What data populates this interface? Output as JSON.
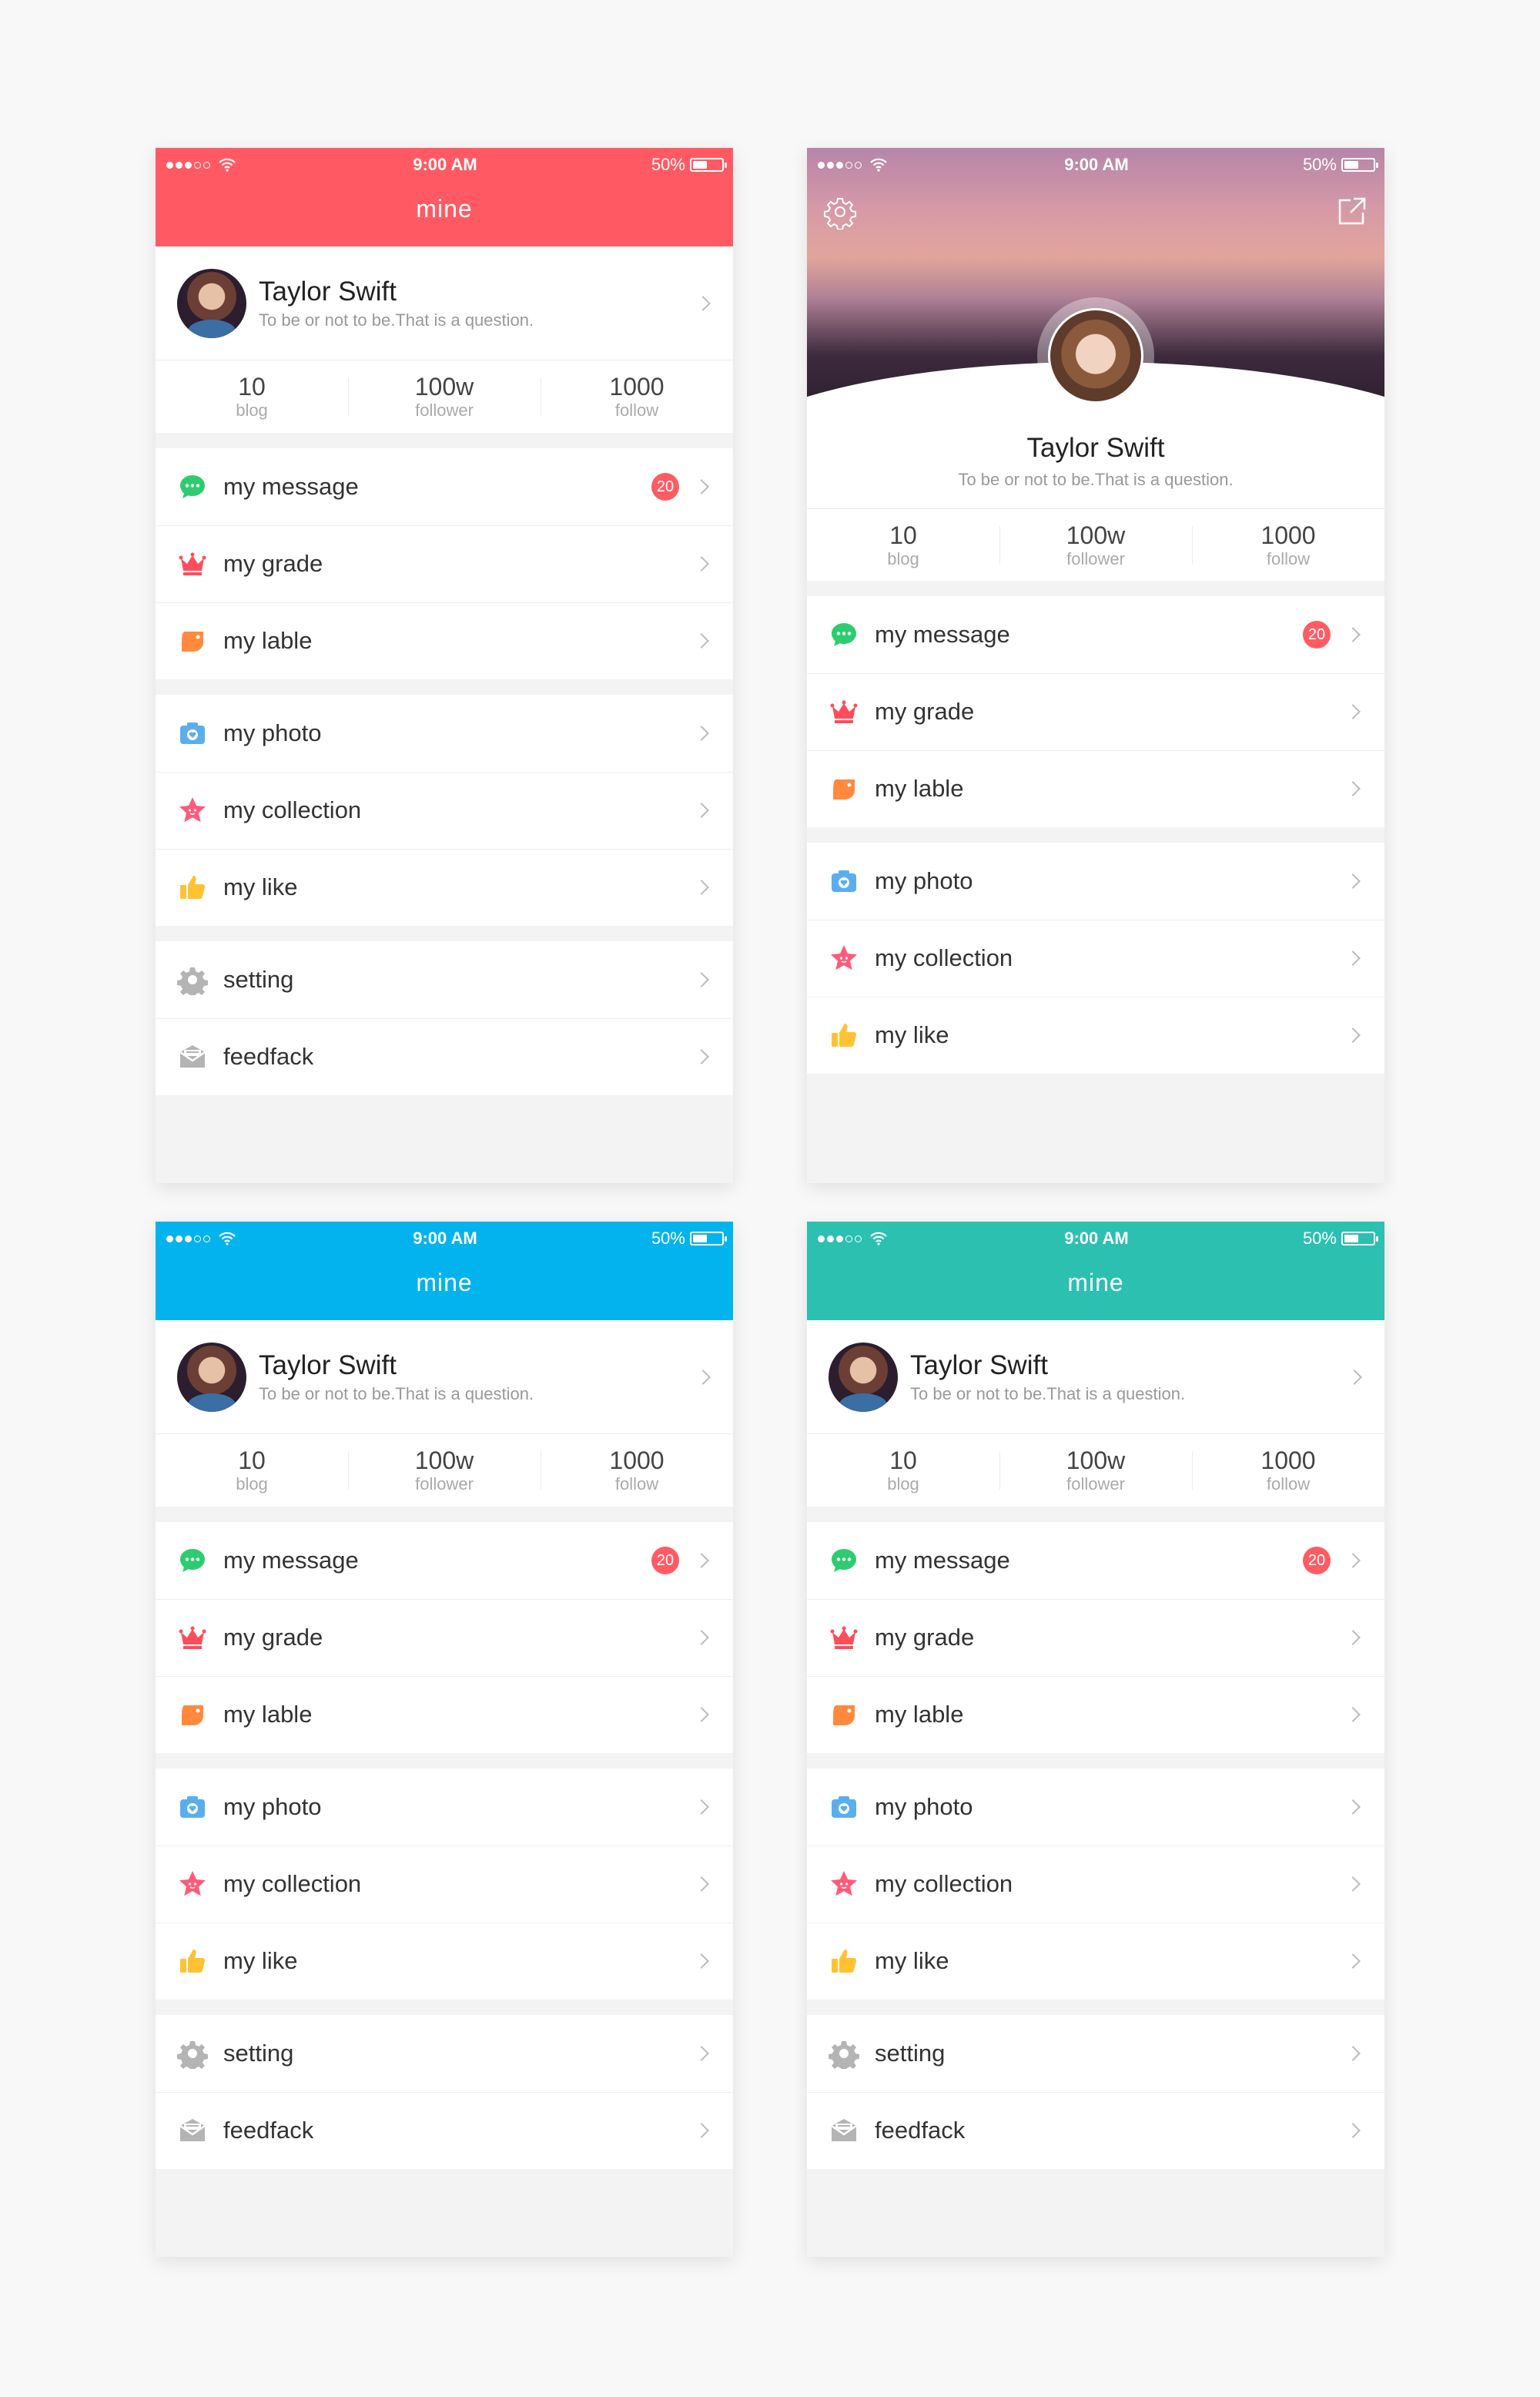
{
  "status": {
    "time": "9:00 AM",
    "battery": "50%"
  },
  "nav_title": "mine",
  "profile": {
    "name": "Taylor Swift",
    "motto": "To be or not to be.That is a question."
  },
  "stats": [
    {
      "value": "10",
      "label": "blog"
    },
    {
      "value": "100w",
      "label": "follower"
    },
    {
      "value": "1000",
      "label": "follow"
    }
  ],
  "menu": {
    "message": "my message",
    "message_badge": "20",
    "grade": "my grade",
    "lable": "my lable",
    "photo": "my photo",
    "collection": "my collection",
    "like": "my like",
    "setting": "setting",
    "feedback": "feedfack"
  },
  "colors": {
    "red_theme": "#ff5a63",
    "blue_theme": "#02b3ed",
    "teal_theme": "#2cc0b1",
    "badge": "#ff5b63",
    "message_icon": "#2ecc71",
    "grade_icon": "#ff4d5c",
    "lable_icon": "#ff8a3d",
    "photo_icon": "#5aaef0",
    "collection_icon": "#ff5a7a",
    "like_icon": "#ffc233",
    "setting_icon": "#b4b4b4",
    "feedback_icon": "#b4b4b4"
  },
  "icons": [
    "chat-bubble-icon",
    "crown-icon",
    "tag-icon",
    "camera-icon",
    "star-icon",
    "thumbs-up-icon",
    "gear-icon",
    "mail-icon",
    "chevron-right-icon",
    "share-icon"
  ]
}
